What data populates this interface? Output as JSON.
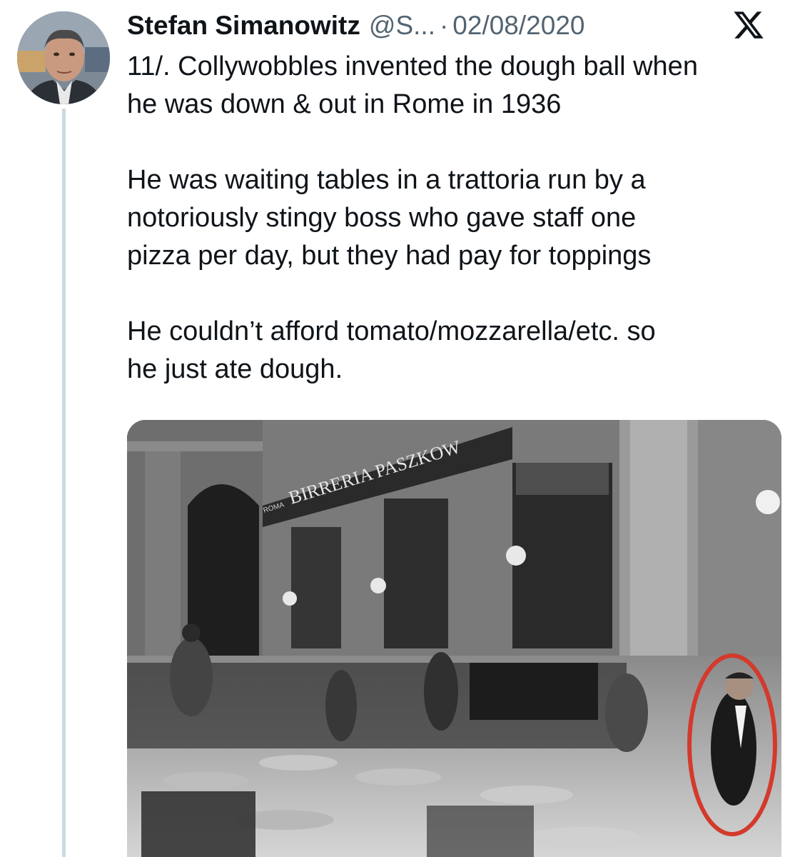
{
  "tweet": {
    "author_name": "Stefan Simanowitz",
    "handle": "@S...",
    "separator": "·",
    "date": "02/08/2020",
    "platform_icon": "x-logo-icon",
    "lines": [
      "11/. Collywobbles invented the dough ball when",
      "he was down & out in Rome in 1936",
      "",
      "He was waiting tables in a trattoria run by a",
      "notoriously stingy boss who gave staff one",
      "pizza per day, but they had pay for toppings",
      "",
      "He couldn’t afford tomato/mozzarella/etc. so",
      "he just ate dough."
    ]
  },
  "media": {
    "sign_text": "BIRRERIA PASZKOW",
    "sign_prefix": "ROMA",
    "photo_style": "black-and-white historic street cafe photo",
    "highlight_color": "#d33a2c"
  },
  "colors": {
    "text": "#0f1419",
    "secondary": "#536471",
    "thread_line": "#cfd9de"
  }
}
